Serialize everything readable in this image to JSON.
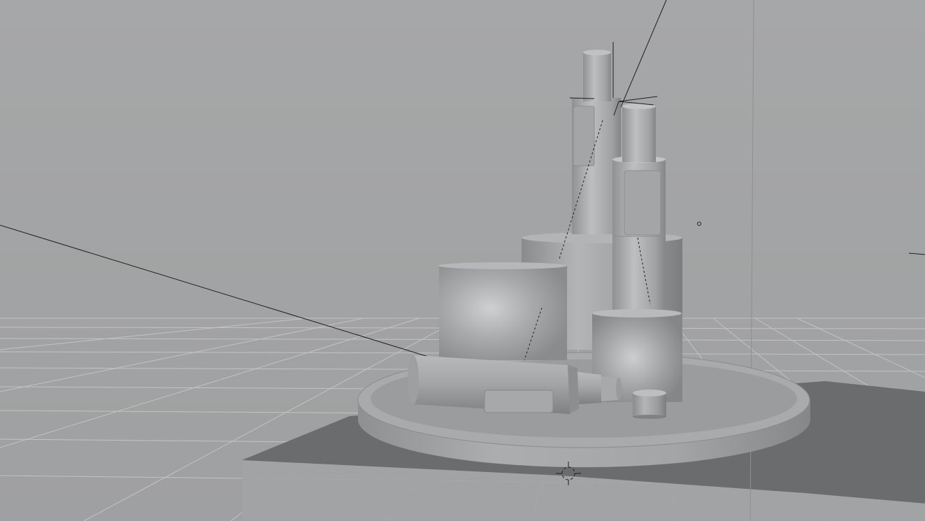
{
  "app": {
    "view": "3D viewport",
    "background_color": "#a3a4a5",
    "floor_color": "#a0a1a2",
    "grid_color": "#c4c5c6",
    "shadow_color": "#6a6b6c",
    "object_color": "#9c9d9e"
  },
  "scene": {
    "objects": [
      "tray",
      "jar",
      "tall-bottle",
      "mid-bottle",
      "lying-tube",
      "small-cap",
      "front-cup"
    ],
    "gizmos": [
      "world-origin-cursor",
      "light-gizmo",
      "camera-guide-lines"
    ]
  },
  "icons": {
    "origin_cursor": "crosshair-icon",
    "light": "point-light-icon"
  }
}
